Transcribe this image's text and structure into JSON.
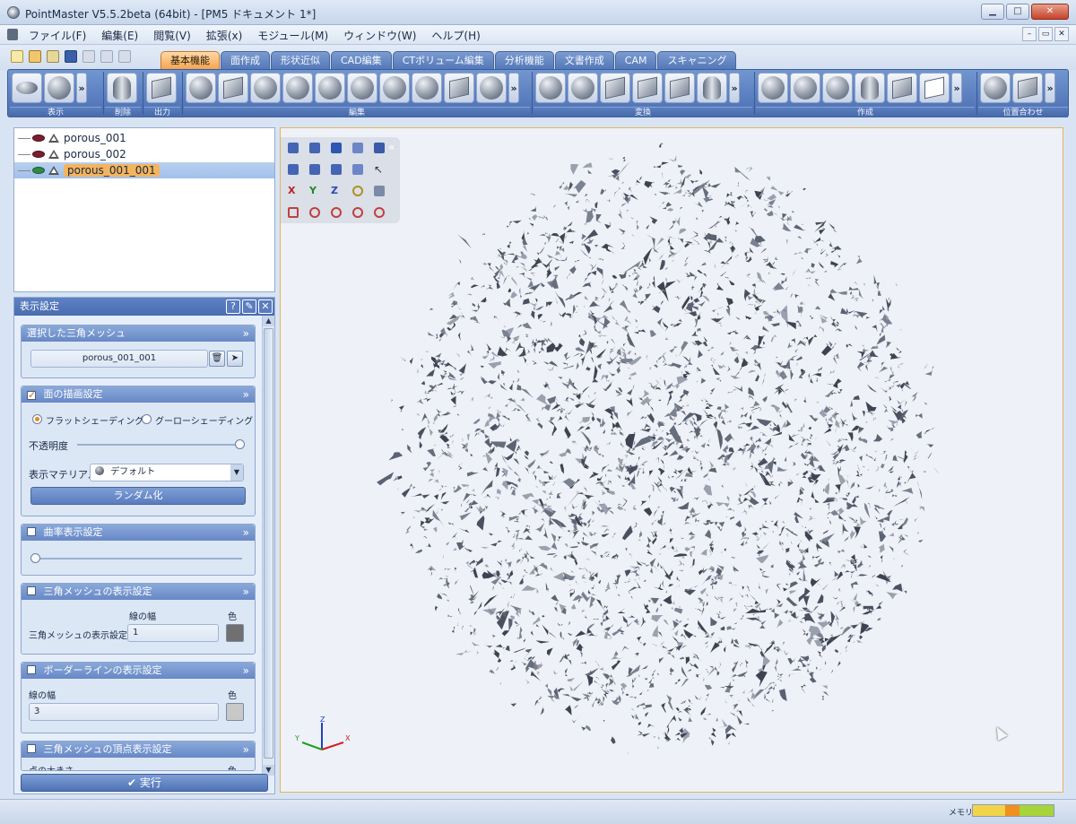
{
  "window": {
    "title": "PointMaster V5.5.2beta (64bit) - [PM5 ドキュメント 1*]",
    "buttons": {
      "minimize": "▁",
      "maximize": "□",
      "close": "✕"
    }
  },
  "menu": {
    "items": [
      "ファイル(F)",
      "編集(E)",
      "閲覧(V)",
      "拡張(x)",
      "モジュール(M)",
      "ウィンドウ(W)",
      "ヘルプ(H)"
    ],
    "mdi": {
      "minimize": "–",
      "restore": "▭",
      "close": "✕"
    }
  },
  "tabs": [
    "基本機能",
    "面作成",
    "形状近似",
    "CAD編集",
    "CTボリューム編集",
    "分析機能",
    "文書作成",
    "CAM",
    "スキャニング"
  ],
  "active_tab": 0,
  "ribbon": {
    "groups": [
      {
        "label": "表示",
        "icons": [
          "eye-icon",
          "shading-icon"
        ]
      },
      {
        "label": "削除",
        "icons": [
          "trash-icon"
        ]
      },
      {
        "label": "出力",
        "icons": [
          "output-icon"
        ]
      },
      {
        "label": "編集",
        "icons": [
          "mesh-cut-icon",
          "mesh-tool-icon",
          "mesh-sphere-icon",
          "mesh-sphere-icon",
          "mesh-sphere-icon",
          "sphere-icon",
          "sphere-icon",
          "sphere-icon",
          "mesh-tool-icon",
          "heart-icon",
          "mesh-tool-icon"
        ]
      },
      {
        "label": "変換",
        "icons": [
          "convert-icon",
          "convert-icon",
          "convert-icon",
          "convert-icon",
          "convert-icon",
          "convert-icon"
        ]
      },
      {
        "label": "作成",
        "icons": [
          "shape-icon",
          "shape-icon",
          "shape-icon",
          "cylinder-icon",
          "cube-icon",
          "curve-icon"
        ]
      },
      {
        "label": "位置合わせ",
        "icons": [
          "align-icon",
          "align-icon"
        ]
      }
    ],
    "more": "»"
  },
  "tree": {
    "items": [
      {
        "name": "porous_001",
        "visible": false
      },
      {
        "name": "porous_002",
        "visible": false
      },
      {
        "name": "porous_001_001",
        "visible": true,
        "selected": true
      }
    ]
  },
  "props": {
    "title": "表示設定",
    "head_buttons": [
      "?",
      "✎",
      "✕"
    ],
    "selected_mesh": {
      "header": "選択した三角メッシュ",
      "value": "porous_001_001"
    },
    "face_render": {
      "header": "面の描画設定",
      "checked": true,
      "flat": "フラットシェーディング",
      "gouraud": "グーローシェーディング",
      "shading_selected": "flat",
      "opacity_label": "不透明度",
      "opacity": 1.0,
      "material_label": "表示マテリアル",
      "material_value": "デフォルト",
      "randomize": "ランダム化"
    },
    "curvature": {
      "header": "曲率表示設定",
      "checked": false,
      "value": 0.0
    },
    "mesh_display": {
      "header": "三角メッシュの表示設定",
      "checked": false,
      "col_width": "線の幅",
      "col_color": "色",
      "row_label": "三角メッシュの表示設定",
      "width": "1",
      "color": "#707070"
    },
    "border_line": {
      "header": "ボーダーラインの表示設定",
      "checked": false,
      "width_label": "線の幅",
      "color_label": "色",
      "width": "3",
      "color": "#c8c8c8"
    },
    "vertex": {
      "header": "三角メッシュの頂点表示設定",
      "checked": false,
      "size_label": "点の大きさ",
      "color_label": "色"
    },
    "section_arrow": "»",
    "execute": "実行"
  },
  "viewport": {
    "axes": {
      "x": "X",
      "y": "Y",
      "z": "Z"
    },
    "tools_collapse": "«"
  },
  "status": {
    "memory_label": "メモリ:"
  }
}
